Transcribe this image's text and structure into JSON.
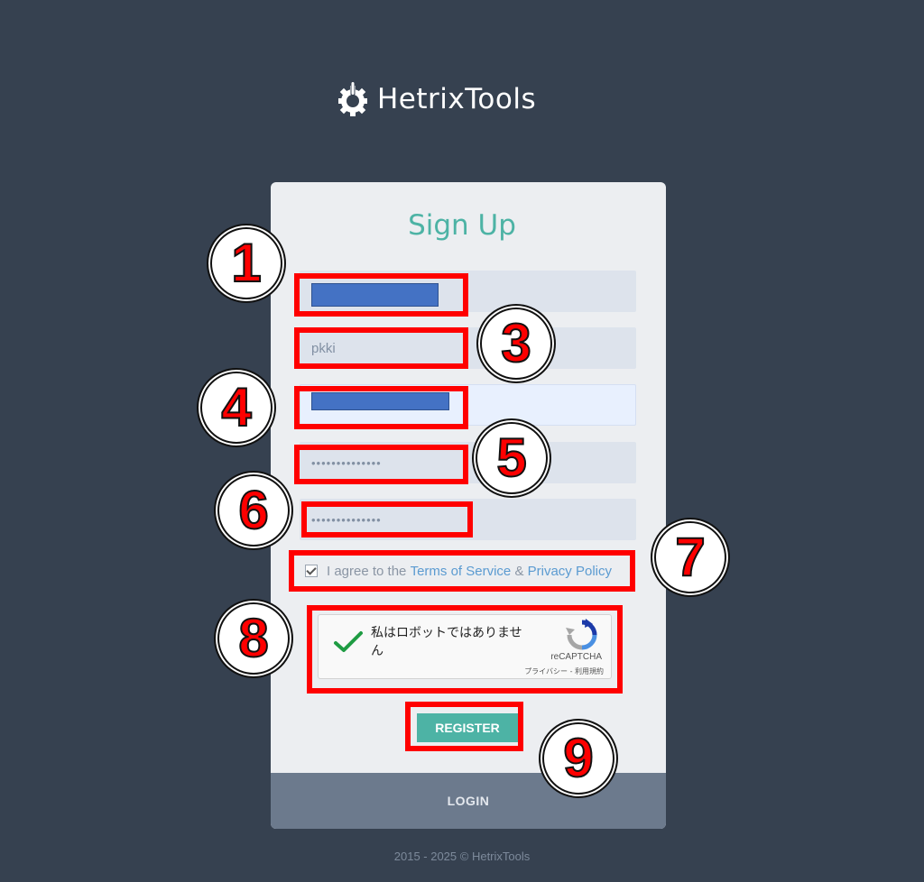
{
  "logo": {
    "text": "HetrixTools",
    "icon": "gear-power-icon"
  },
  "form": {
    "title": "Sign Up",
    "fields": [
      {
        "name": "username",
        "value": ""
      },
      {
        "name": "name",
        "value": "pkki"
      },
      {
        "name": "email",
        "value": ""
      },
      {
        "name": "password",
        "value": "••••••••••••••"
      },
      {
        "name": "confirm_password",
        "value": "••••••••••••••"
      }
    ],
    "terms": {
      "prefix": "I agree to the ",
      "tos": "Terms of Service",
      "amp": " & ",
      "privacy": "Privacy Policy",
      "checked": true
    },
    "captcha": {
      "text": "私はロボットではありません",
      "brand": "reCAPTCHA",
      "links": "プライバシー - 利用規約",
      "checked": true
    },
    "register_label": "REGISTER",
    "login_label": "LOGIN"
  },
  "footer": {
    "text": "2015 - 2025 © HetrixTools"
  },
  "annotations": [
    "1",
    "3",
    "4",
    "5",
    "6",
    "7",
    "8",
    "9"
  ],
  "colors": {
    "background": "#364150",
    "accent": "#4db3a5",
    "link": "#5b9bd1",
    "annotation": "#ff0000",
    "redaction": "#4472c4"
  }
}
